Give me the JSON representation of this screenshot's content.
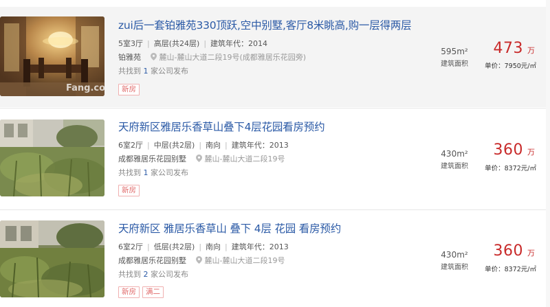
{
  "listings": [
    {
      "title": "zui后一套铂雅苑330顶跃,空中别墅,客厅8米眺高,购一层得两层",
      "layout": "5室3厅",
      "floor": "高层(共24层)",
      "orientation": "",
      "year": "建筑年代：2014",
      "community": "铂雅苑",
      "address": "麓山-麓山大道二段19号(成都雅居乐花园旁)",
      "agency_prefix": "共找到",
      "agency_count": "1",
      "agency_suffix": "家公司发布",
      "tags": [
        "新房"
      ],
      "area_value": "595",
      "area_unit": "m²",
      "area_label": "建筑面积",
      "price": "473",
      "price_unit": "万",
      "unit_price": "单价：7950元/㎡",
      "watermark": "Fang.com"
    },
    {
      "title": "天府新区雅居乐香草山叠下4层花园看房预约",
      "layout": "6室2厅",
      "floor": "中层(共2层)",
      "orientation": "南向",
      "year": "建筑年代：2013",
      "community": "成都雅居乐花园别墅",
      "address": "麓山-麓山大道二段19号",
      "agency_prefix": "共找到",
      "agency_count": "1",
      "agency_suffix": "家公司发布",
      "tags": [
        "新房"
      ],
      "area_value": "430",
      "area_unit": "m²",
      "area_label": "建筑面积",
      "price": "360",
      "price_unit": "万",
      "unit_price": "单价：8372元/㎡"
    },
    {
      "title": "天府新区 雅居乐香草山 叠下 4层 花园 看房预约",
      "layout": "6室2厅",
      "floor": "低层(共2层)",
      "orientation": "南向",
      "year": "建筑年代：2013",
      "community": "成都雅居乐花园别墅",
      "address": "麓山-麓山大道二段19号",
      "agency_prefix": "共找到",
      "agency_count": "2",
      "agency_suffix": "家公司发布",
      "tags": [
        "新房",
        "满二"
      ],
      "area_value": "430",
      "area_unit": "m²",
      "area_label": "建筑面积",
      "price": "360",
      "price_unit": "万",
      "unit_price": "单价：8372元/㎡"
    }
  ],
  "colors": {
    "title": "#2b5aa6",
    "price": "#c82a2a",
    "tag_text": "#e06a6a",
    "tag_border": "#f0b0b0",
    "highlight_bg": "#f4f4f4"
  }
}
